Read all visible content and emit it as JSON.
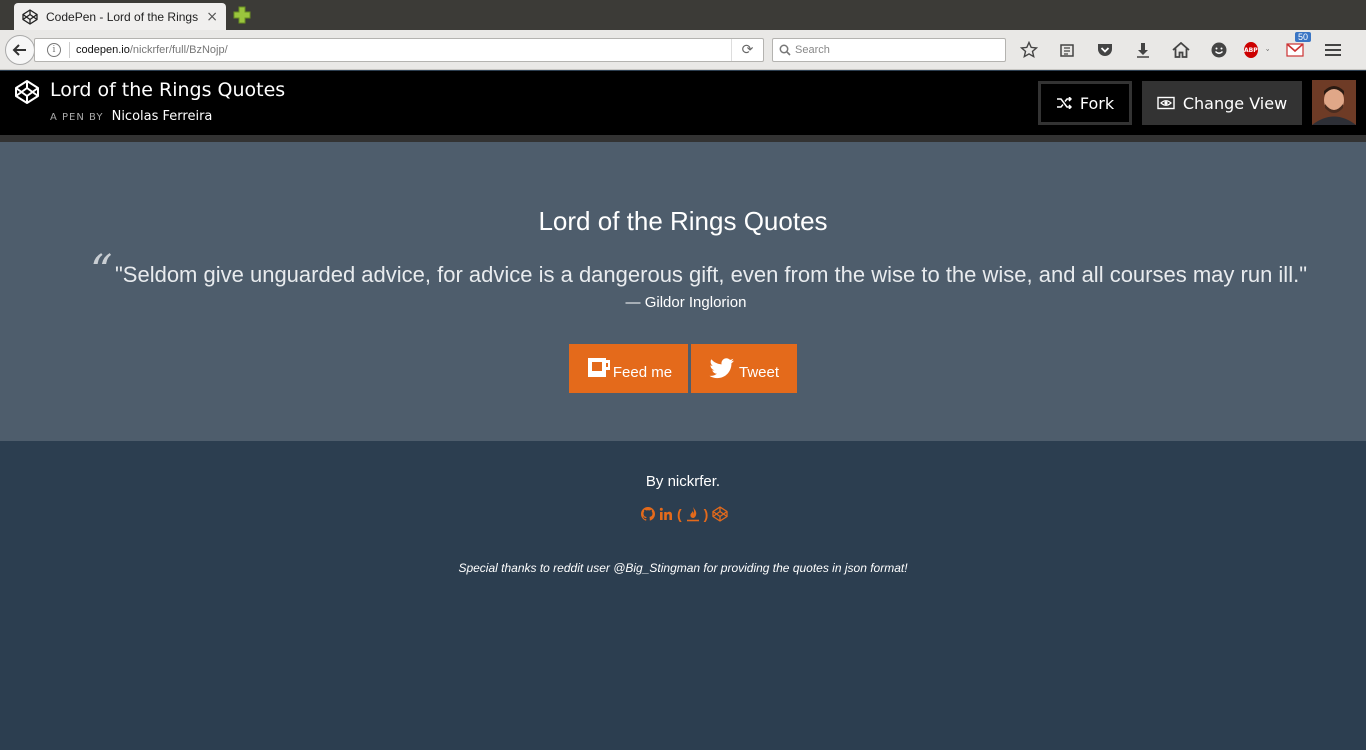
{
  "browser": {
    "tab_title": "CodePen - Lord of the Rings ...",
    "tab_close": "×",
    "url_host": "codepen.io",
    "url_path": "/nickrfer/full/BzNojp/",
    "search_placeholder": "Search",
    "gmail_count": "50",
    "abp_label": "ABP"
  },
  "codepen": {
    "title": "Lord of the Rings Quotes",
    "pen_by": "A PEN BY",
    "author": "Nicolas Ferreira",
    "fork_label": "Fork",
    "change_view_label": "Change View"
  },
  "quote": {
    "heading": "Lord of the Rings Quotes",
    "mark": "“",
    "text": "\"Seldom give unguarded advice, for advice is a dangerous gift, even from the wise to the wise, and all courses may run ill.\"",
    "author": "— Gildor Inglorion",
    "feed_label": "Feed me",
    "tweet_label": "Tweet"
  },
  "footer": {
    "by": "By nickrfer.",
    "paren_open": "(",
    "paren_close": ")",
    "thanks": "Special thanks to reddit user @Big_Stingman for providing the quotes in json format!"
  },
  "colors": {
    "header_bg": "#000000",
    "quote_bg": "#4e5d6c",
    "footer_bg": "#2c3e50",
    "accent": "#e46a1b"
  }
}
